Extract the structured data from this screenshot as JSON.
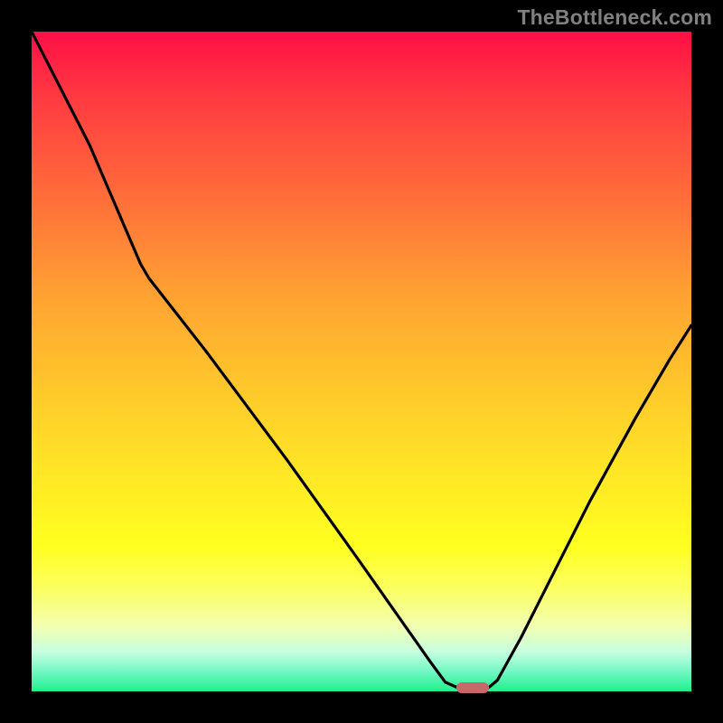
{
  "watermark": "TheBottleneck.com",
  "chart_data": {
    "type": "line",
    "title": "",
    "xlabel": "",
    "ylabel": "",
    "xlim": [
      0,
      1
    ],
    "ylim": [
      0,
      1
    ],
    "grid": false,
    "series": [
      {
        "name": "bottleneck-curve",
        "points": [
          {
            "x": 0.0,
            "y": 0.0
          },
          {
            "x": 0.088,
            "y": 0.172
          },
          {
            "x": 0.165,
            "y": 0.352
          },
          {
            "x": 0.178,
            "y": 0.374
          },
          {
            "x": 0.264,
            "y": 0.484
          },
          {
            "x": 0.387,
            "y": 0.649
          },
          {
            "x": 0.495,
            "y": 0.8
          },
          {
            "x": 0.605,
            "y": 0.956
          },
          {
            "x": 0.627,
            "y": 0.986
          },
          {
            "x": 0.645,
            "y": 0.994
          },
          {
            "x": 0.693,
            "y": 0.994
          },
          {
            "x": 0.706,
            "y": 0.983
          },
          {
            "x": 0.742,
            "y": 0.918
          },
          {
            "x": 0.791,
            "y": 0.821
          },
          {
            "x": 0.846,
            "y": 0.712
          },
          {
            "x": 0.915,
            "y": 0.586
          },
          {
            "x": 0.967,
            "y": 0.497
          },
          {
            "x": 1.0,
            "y": 0.445
          }
        ]
      }
    ],
    "marker": {
      "x": 0.668,
      "y": 0.994
    },
    "colors": {
      "gradient_top": "#ff0e46",
      "gradient_bottom": "#1ef08a",
      "curve": "#000000",
      "marker": "#c96869",
      "frame": "#000000"
    }
  }
}
